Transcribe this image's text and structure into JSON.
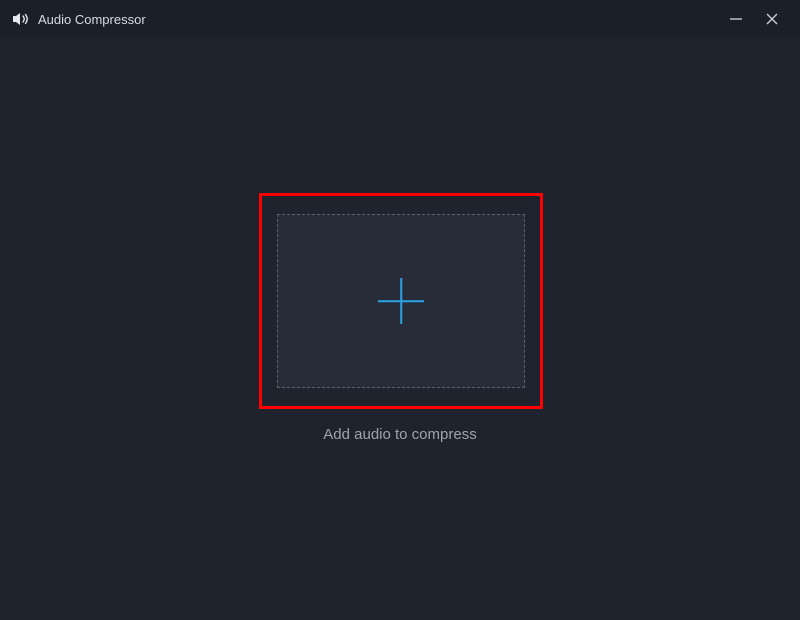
{
  "titlebar": {
    "app_title": "Audio Compressor"
  },
  "main": {
    "hint_text": "Add audio to compress"
  },
  "icons": {
    "app": "audio-compressor-icon",
    "minimize": "minimize-icon",
    "close": "close-icon",
    "plus": "plus-icon"
  },
  "colors": {
    "accent": "#2aa3e6",
    "highlight": "#ff0000",
    "bg": "#1f232d"
  }
}
